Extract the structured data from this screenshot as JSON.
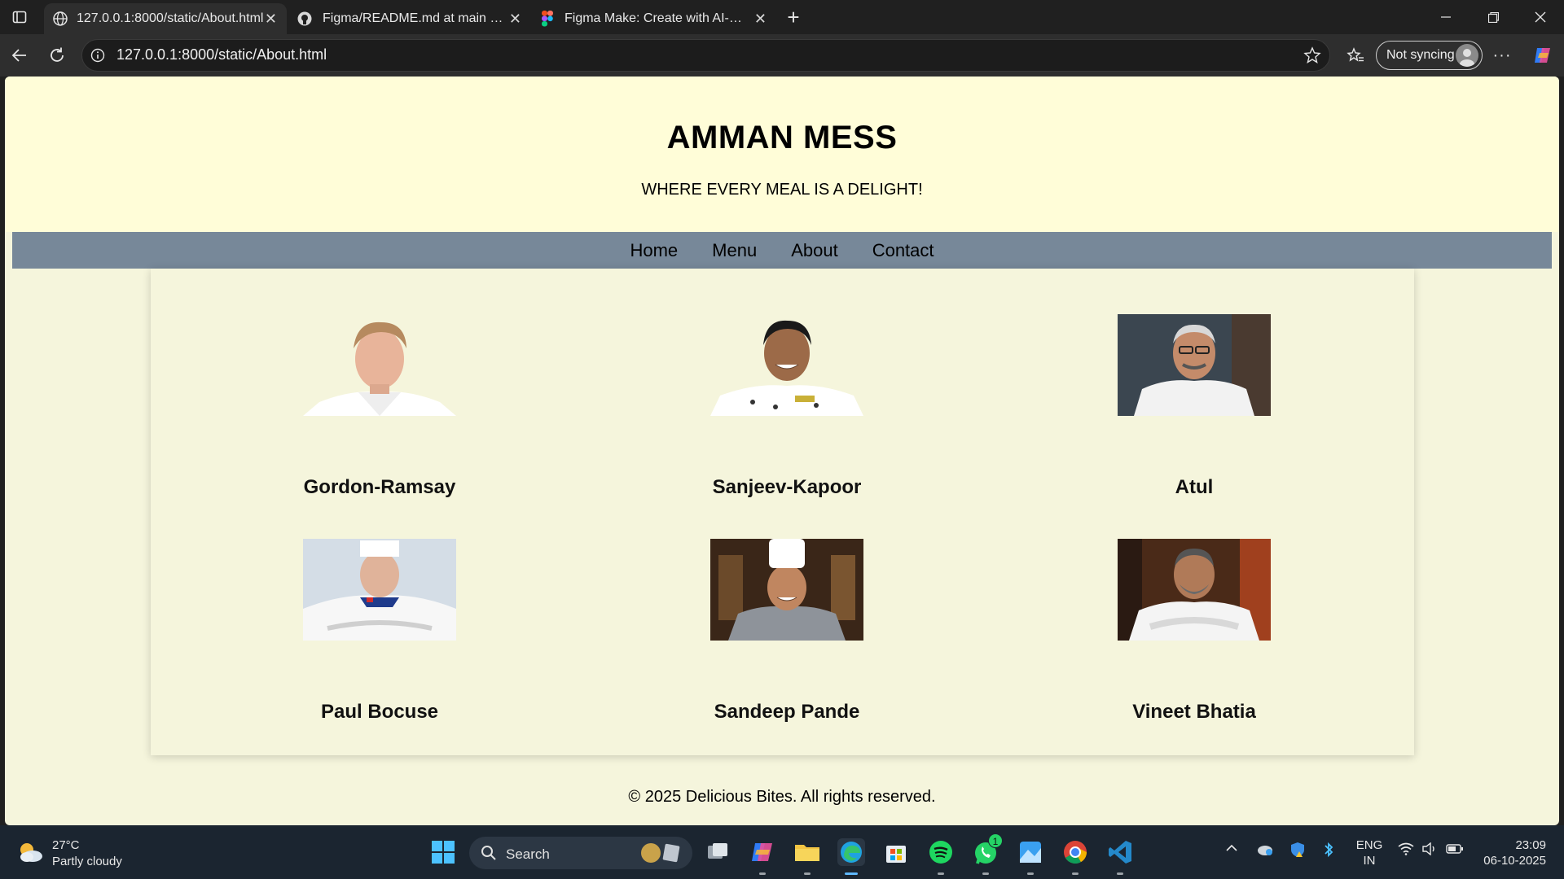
{
  "browser": {
    "tabs": [
      {
        "title": "127.0.0.1:8000/static/About.html",
        "active": true,
        "icon": "globe-icon"
      },
      {
        "title": "Figma/README.md at main · udh",
        "active": false,
        "icon": "github-icon"
      },
      {
        "title": "Figma Make: Create with AI-Powe",
        "active": false,
        "icon": "figma-icon"
      }
    ],
    "address": "127.0.0.1:8000/static/About.html",
    "profile_label": "Not syncing"
  },
  "site": {
    "title": "AMMAN MESS",
    "tagline": "WHERE EVERY MEAL IS A DELIGHT!",
    "nav": [
      "Home",
      "Menu",
      "About",
      "Contact"
    ],
    "chefs": [
      {
        "name": "Gordon-Ramsay"
      },
      {
        "name": "Sanjeev-Kapoor"
      },
      {
        "name": "Atul"
      },
      {
        "name": "Paul Bocuse"
      },
      {
        "name": "Sandeep Pande"
      },
      {
        "name": "Vineet Bhatia"
      }
    ],
    "footer": "© 2025 Delicious Bites. All rights reserved."
  },
  "taskbar": {
    "weather_temp": "27°C",
    "weather_condition": "Partly cloudy",
    "search_label": "Search",
    "whatsapp_badge": "1",
    "lang_top": "ENG",
    "lang_bottom": "IN",
    "time": "23:09",
    "date": "06-10-2025"
  },
  "colors": {
    "header_bg": "#fffdd8",
    "nav_bg": "#778899",
    "page_bg": "#f5f5dc"
  }
}
